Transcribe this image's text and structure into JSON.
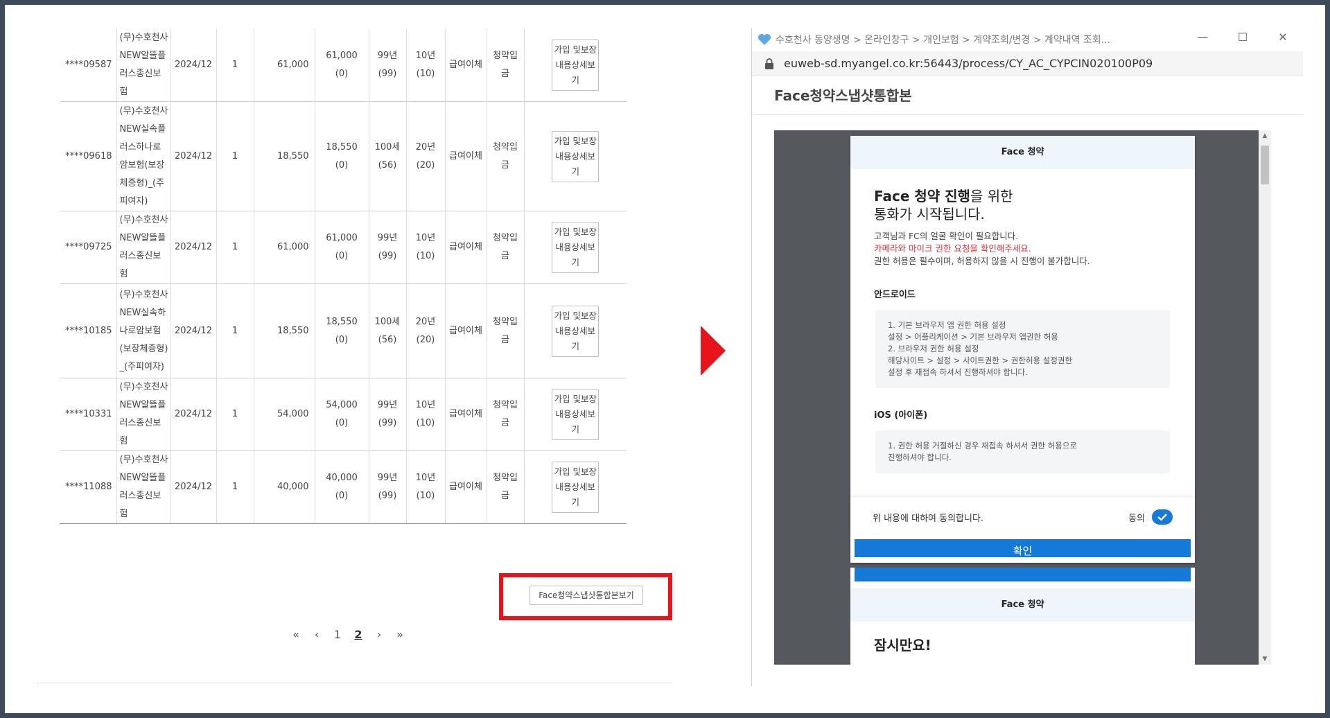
{
  "contracts": [
    {
      "no": "****09587",
      "product": "(무)수호천사NEW알뜰플러스종신보험",
      "date": "2024/12",
      "count": "1",
      "premium": "61,000",
      "paid_main": "61,000",
      "paid_sub": "(0)",
      "period_main": "99년",
      "period_sub": "(99)",
      "pay_main": "10년",
      "pay_sub": "(10)",
      "method": "급여이체",
      "status": "청약입금",
      "detail_label": "가입 및보장내용상세보기"
    },
    {
      "no": "****09618",
      "product": "(무)수호천사NEW실속플러스하나로암보험(보장체증형)_(주피여자)",
      "date": "2024/12",
      "count": "1",
      "premium": "18,550",
      "paid_main": "18,550",
      "paid_sub": "(0)",
      "period_main": "100세",
      "period_sub": "(56)",
      "pay_main": "20년",
      "pay_sub": "(20)",
      "method": "급여이체",
      "status": "청약입금",
      "detail_label": "가입 및보장내용상세보기"
    },
    {
      "no": "****09725",
      "product": "(무)수호천사NEW알뜰플러스종신보험",
      "date": "2024/12",
      "count": "1",
      "premium": "61,000",
      "paid_main": "61,000",
      "paid_sub": "(0)",
      "period_main": "99년",
      "period_sub": "(99)",
      "pay_main": "10년",
      "pay_sub": "(10)",
      "method": "급여이체",
      "status": "청약입금",
      "detail_label": "가입 및보장내용상세보기"
    },
    {
      "no": "****10185",
      "product": "(무)수호천사NEW실속하나로암보험(보장체증형)_(주피여자)",
      "date": "2024/12",
      "count": "1",
      "premium": "18,550",
      "paid_main": "18,550",
      "paid_sub": "(0)",
      "period_main": "100세",
      "period_sub": "(56)",
      "pay_main": "20년",
      "pay_sub": "(20)",
      "method": "급여이체",
      "status": "청약입금",
      "detail_label": "가입 및보장내용상세보기"
    },
    {
      "no": "****10331",
      "product": "(무)수호천사NEW알뜰플러스종신보험",
      "date": "2024/12",
      "count": "1",
      "premium": "54,000",
      "paid_main": "54,000",
      "paid_sub": "(0)",
      "period_main": "99년",
      "period_sub": "(99)",
      "pay_main": "10년",
      "pay_sub": "(10)",
      "method": "급여이체",
      "status": "청약입금",
      "detail_label": "가입 및보장내용상세보기"
    },
    {
      "no": "****11088",
      "product": "(무)수호천사NEW알뜰플러스종신보험",
      "date": "2024/12",
      "count": "1",
      "premium": "40,000",
      "paid_main": "40,000",
      "paid_sub": "(0)",
      "period_main": "99년",
      "period_sub": "(99)",
      "pay_main": "10년",
      "pay_sub": "(10)",
      "method": "급여이체",
      "status": "청약입금",
      "detail_label": "가입 및보장내용상세보기"
    }
  ],
  "face_button_label": "Face청약스냅샷통합본보기",
  "pagination": {
    "first": "«",
    "prev": "‹",
    "pages": [
      "1",
      "2"
    ],
    "next": "›",
    "last": "»"
  },
  "popup": {
    "window_title": "수호천사 동양생명 > 온라인창구 > 개인보험 > 계약조회/변경 > 계약내역 조회...",
    "url": "euweb-sd.myangel.co.kr:56443/process/CY_AC_CYPCIN020100P09",
    "heading": "Face청약스냅샷통합본",
    "minimize": "—",
    "maximize": "☐",
    "close": "✕",
    "page1": {
      "header": "Face 청약",
      "title_bold": "Face 청약 진행",
      "title_rest1": "을 위한",
      "title_line2": "통화가 시작됩니다.",
      "desc1": "고객님과 FC의 얼굴 확인이 필요합니다.",
      "desc_warn": "카메라와 마이크 권한 요청을 확인해주세요.",
      "desc2": "권한 허용은 필수이며, 허용하지 않을 시 진행이 불가합니다.",
      "android_title": "안드로이드",
      "android_lines": [
        "1. 기본 브라우저 앱 권한 허용 설정",
        "설정 > 어플리케이션 > 기본 브라우저 앱권한 허용",
        "2. 브라우저 권한 허용 설정",
        "해당사이트 > 설정 > 사이트권한 > 권한허용 설정권한",
        "설정 후 재접속 하셔서 진행하셔야 합니다."
      ],
      "ios_title": "iOS (아이폰)",
      "ios_lines": [
        "1. 권한 허용 거절하신 경우 재접속 하셔서 권한 허용으로",
        "진행하셔야 합니다."
      ],
      "agree_text": "위 내용에 대하여 동의합니다.",
      "agree_label": "동의",
      "confirm_label": "확인"
    },
    "page2": {
      "header": "Face 청약",
      "title": "잠시만요!"
    }
  },
  "colors": {
    "highlight": "#e8141b",
    "primary": "#1479d7",
    "frame": "#3e4a5c"
  }
}
